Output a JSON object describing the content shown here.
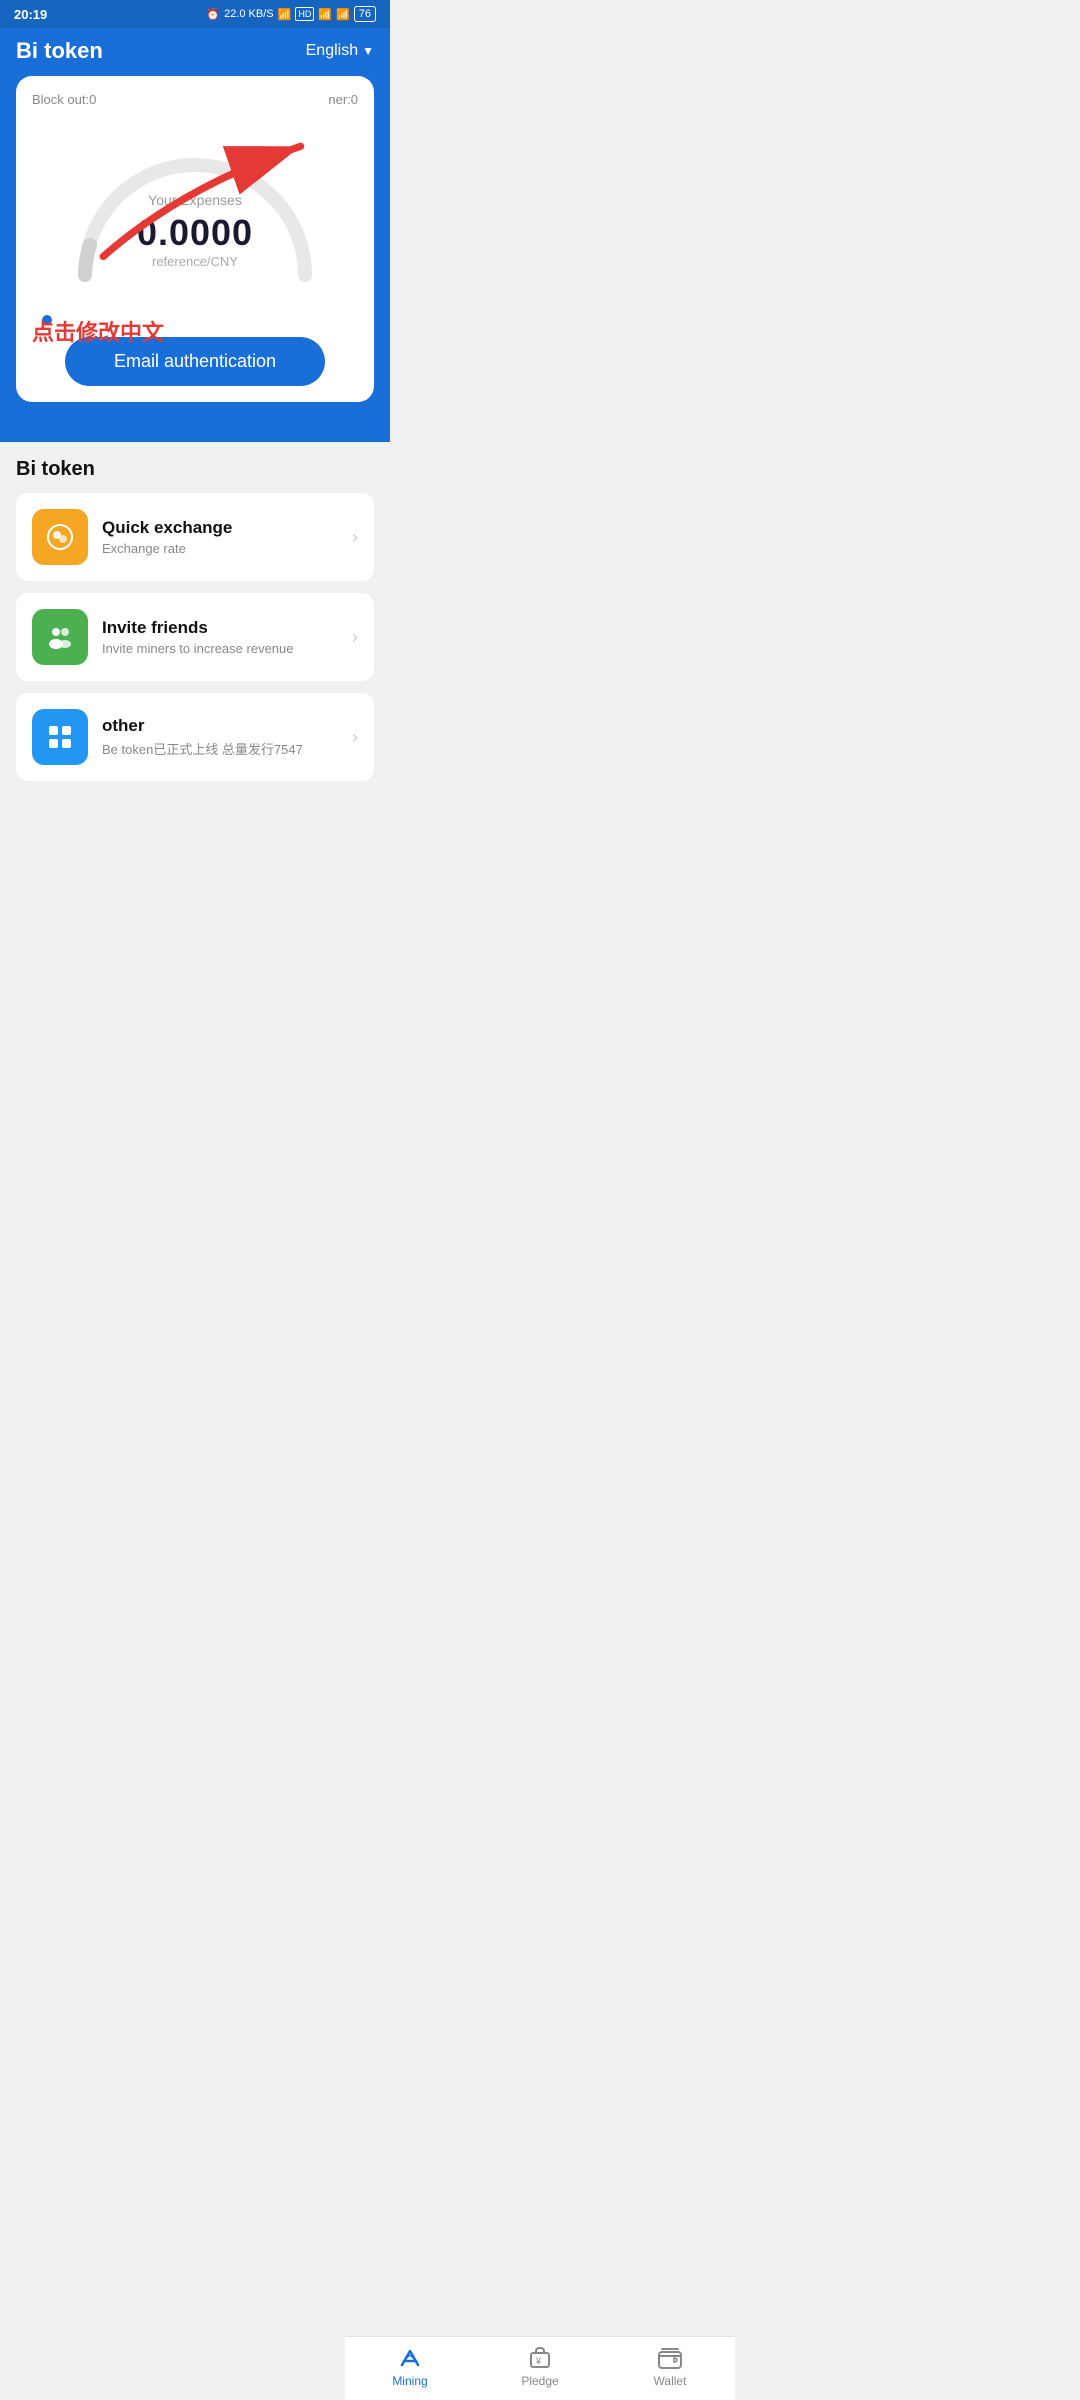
{
  "status": {
    "time": "20:19",
    "network": "22.0 KB/S",
    "battery": "76"
  },
  "header": {
    "title": "Bi token",
    "language": "English"
  },
  "card": {
    "block_out_label": "Block out:",
    "block_out_value": "0",
    "miner_label": "ner:0",
    "expenses_label": "Your Expenses",
    "expenses_value": "0.0000",
    "unit": "reference/CNY",
    "chinese_text": "点击修改中文",
    "email_btn": "Email authentication"
  },
  "content": {
    "section_title": "Bi token",
    "menu_items": [
      {
        "id": "quick-exchange",
        "title": "Quick exchange",
        "subtitle": "Exchange rate",
        "icon": "💰"
      },
      {
        "id": "invite-friends",
        "title": "Invite friends",
        "subtitle": "Invite miners to increase revenue",
        "icon": "👥"
      },
      {
        "id": "other",
        "title": "other",
        "subtitle": "Be token已正式上线 总量发行7547",
        "icon": "⊞"
      }
    ]
  },
  "bottom_nav": {
    "items": [
      {
        "id": "mining",
        "label": "Mining",
        "active": true
      },
      {
        "id": "pledge",
        "label": "Pledge",
        "active": false
      },
      {
        "id": "wallet",
        "label": "Wallet",
        "active": false
      }
    ]
  }
}
